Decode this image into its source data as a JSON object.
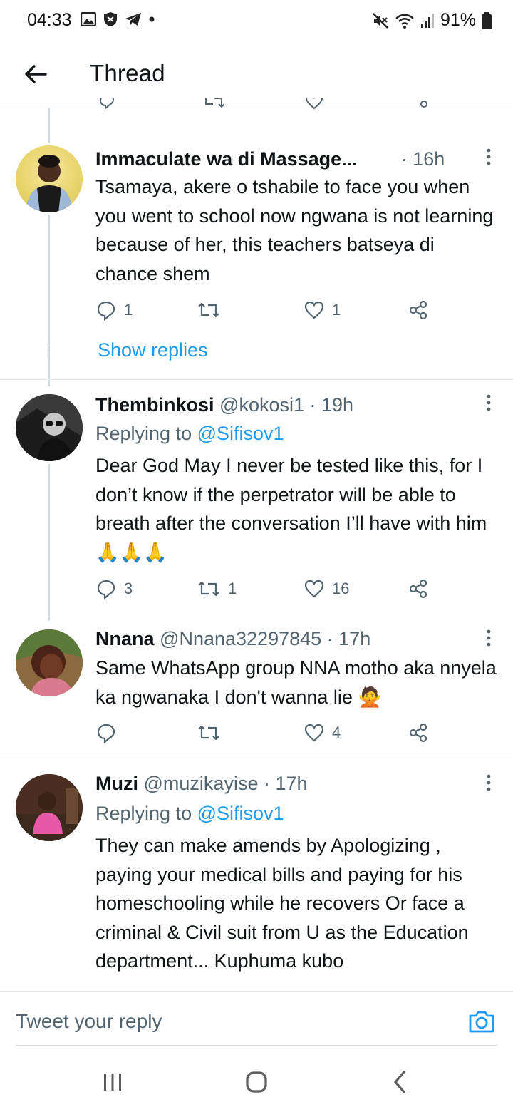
{
  "status_bar": {
    "time": "04:33",
    "battery": "91%",
    "icons_left": [
      "gallery-icon",
      "shield-icon",
      "telegram-icon",
      "dot-icon"
    ],
    "icons_right": [
      "mute-icon",
      "wifi-icon",
      "signal-icon",
      "battery-icon"
    ]
  },
  "header": {
    "title": "Thread"
  },
  "tweets": [
    {
      "name": "Immaculate wa di Massage...",
      "handle": "",
      "time": "· 16h",
      "replying_to_prefix": "",
      "replying_to": "",
      "body": "Tsamaya, akere o tshabile to face you when you went to school now ngwana is not learning because of her, this teachers batseya di chance shem",
      "replies": "1",
      "retweets": "",
      "likes": "1",
      "show_replies": "Show replies"
    },
    {
      "name": "Thembinkosi",
      "handle": "@kokosi1",
      "time": "· 19h",
      "replying_to_prefix": "Replying to ",
      "replying_to": "@Sifisov1",
      "body": "Dear God May I never be tested like this, for I don’t know if the perpetrator will be able to breath after the conversation I’ll have with him",
      "emoji": "🙏🙏🙏",
      "replies": "3",
      "retweets": "1",
      "likes": "16"
    },
    {
      "name": "Nnana",
      "handle": "@Nnana32297845",
      "time": "· 17h",
      "body": "Same WhatsApp group NNA motho aka nnyela ka ngwanaka I don't wanna lie",
      "emoji": "🙅",
      "replies": "",
      "retweets": "",
      "likes": "4"
    },
    {
      "name": "Muzi",
      "handle": "@muzikayise",
      "time": "· 17h",
      "replying_to_prefix": "Replying to ",
      "replying_to": "@Sifisov1",
      "body": "They can make amends by Apologizing , paying your medical bills and paying for his homeschooling while he recovers Or face a criminal & Civil suit from U as the Education department... Kuphuma kubo"
    }
  ],
  "reply_box": {
    "placeholder": "Tweet your reply"
  },
  "colors": {
    "accent": "#1d9bf0",
    "secondary_text": "#536471",
    "primary_text": "#0f1419"
  }
}
